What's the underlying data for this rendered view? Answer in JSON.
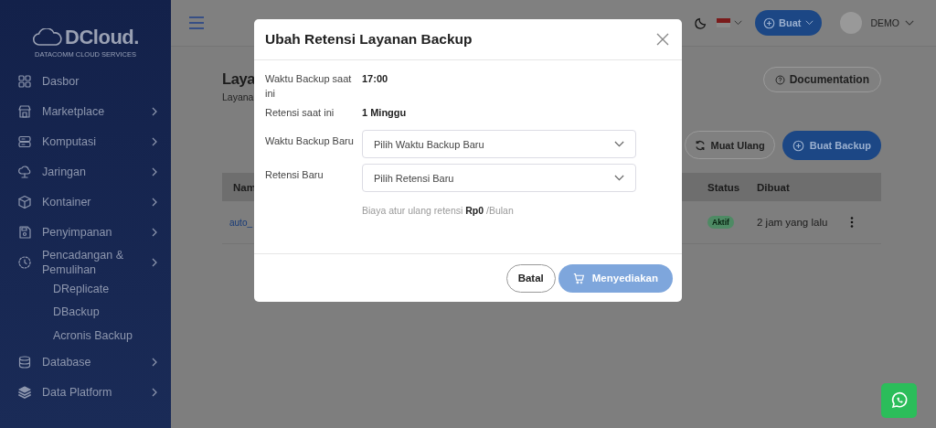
{
  "sidebar": {
    "logo": {
      "name": "DCloud.",
      "tagline": "DATACOMM CLOUD SERVICES"
    },
    "items": [
      {
        "label": "Dasbor",
        "expandable": false
      },
      {
        "label": "Marketplace",
        "expandable": true
      },
      {
        "label": "Komputasi",
        "expandable": true
      },
      {
        "label": "Jaringan",
        "expandable": true
      },
      {
        "label": "Kontainer",
        "expandable": true
      },
      {
        "label": "Penyimpanan",
        "expandable": true
      },
      {
        "label": "Pencadangan & Pemulihan",
        "expandable": true,
        "children": [
          {
            "label": "DReplicate"
          },
          {
            "label": "DBackup"
          },
          {
            "label": "Acronis Backup"
          }
        ]
      },
      {
        "label": "Database",
        "expandable": true
      },
      {
        "label": "Data Platform",
        "expandable": true
      }
    ]
  },
  "topbar": {
    "create_button": "Buat",
    "user": "DEMO"
  },
  "page": {
    "title": "Laya",
    "subtitle": "Layana",
    "documentation_button": "Documentation",
    "reload_button": "Muat Ulang",
    "create_backup_button": "Buat Backup",
    "table": {
      "columns": [
        "Nam",
        "Status",
        "Dibuat"
      ],
      "rows": [
        {
          "name": "auto_",
          "status": "Aktif",
          "created": "2 jam yang lalu"
        }
      ]
    }
  },
  "modal": {
    "title": "Ubah Retensi Layanan Backup",
    "info": [
      {
        "label": "Waktu Backup saat ini",
        "value": "17:00"
      },
      {
        "label": "Retensi saat ini",
        "value": "1 Minggu"
      }
    ],
    "fields": [
      {
        "label": "Waktu Backup Baru",
        "placeholder": "Pilih Waktu Backup Baru"
      },
      {
        "label": "Retensi Baru",
        "placeholder": "Pilih Retensi Baru"
      }
    ],
    "note": "Biaya atur ulang retensi **Rp0** /Bulan",
    "buttons": [
      {
        "label": "Batal",
        "kind": "secondary",
        "disabled": false
      },
      {
        "label": "Menyediakan",
        "kind": "primary",
        "disabled": true
      }
    ]
  }
}
